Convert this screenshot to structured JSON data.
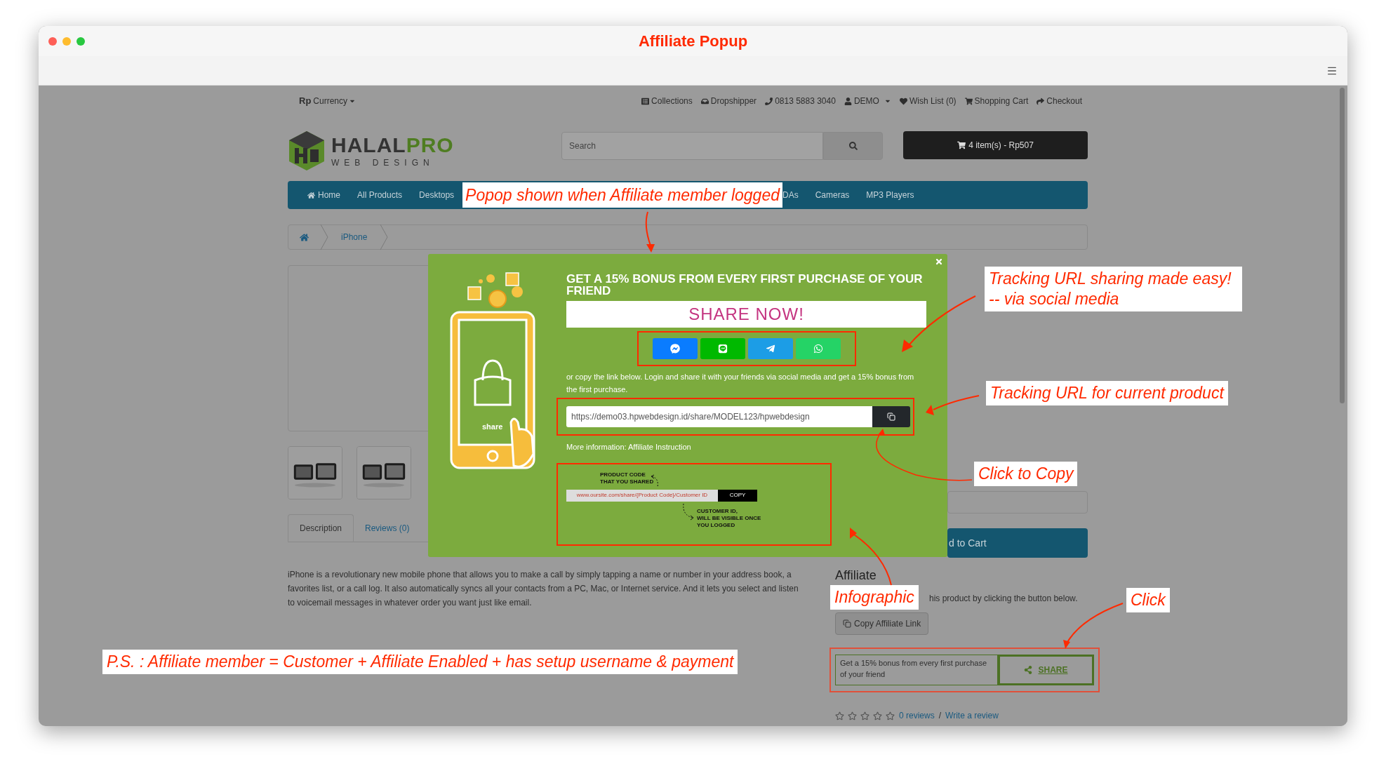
{
  "window": {
    "title": "Affiliate Popup"
  },
  "top_bar": {
    "currency_symbol": "Rp",
    "currency_label": "Currency",
    "links": [
      {
        "label": "Collections",
        "dropdown": false
      },
      {
        "label": "Dropshipper",
        "dropdown": false
      },
      {
        "label": "0813 5883 3040",
        "dropdown": false
      },
      {
        "label": "DEMO",
        "dropdown": true
      },
      {
        "label": "Wish List (0)",
        "dropdown": false
      },
      {
        "label": "Shopping Cart",
        "dropdown": false
      },
      {
        "label": "Checkout",
        "dropdown": false
      }
    ]
  },
  "header": {
    "logo_dark": "HALAL",
    "logo_green": "PRO",
    "logo_sub": "WEB DESIGN",
    "search": {
      "placeholder": "Search"
    },
    "cart": "4 item(s) - Rp507"
  },
  "nav": {
    "items_before": [
      "Home",
      "All Products",
      "Desktops"
    ],
    "annotation": "Popop shown when Affiliate member logged",
    "items_after": [
      "DAs",
      "Cameras",
      "MP3 Players"
    ]
  },
  "breadcrumb": [
    "iPhone"
  ],
  "thumbnails": [
    {
      "kind": "picture"
    },
    {
      "kind": "picture"
    }
  ],
  "tabs": [
    {
      "label": "Description",
      "selected": true
    },
    {
      "label": "Reviews (0)",
      "selected": false
    }
  ],
  "description": "iPhone is a revolutionary new mobile phone that allows you to make a call by simply tapping a name or number in your address book, a favorites list, or a call log. It also automatically syncs all your contacts from a PC, Mac, or Internet service. And it lets you select and listen to voicemail messages in whatever order you want just like email.",
  "right": {
    "cart_button": "d to Cart",
    "affiliate_heading": "Affiliate",
    "affiliate_text": "his product by clicking the button below.",
    "copy_button": "Copy Affiliate Link",
    "share_box": {
      "text": "Get a 15% bonus from every first purchase of your friend",
      "button": "SHARE"
    },
    "stars": 0,
    "reviews_link": "0 reviews",
    "separator": "/",
    "write_link": "Write a review"
  },
  "popup": {
    "illustration_label": "share",
    "heading": "GET A 15% BONUS FROM EVERY FIRST PURCHASE OF YOUR FRIEND",
    "banner": "SHARE NOW!",
    "social": [
      {
        "kind": "messenger",
        "color": "#0a7cff"
      },
      {
        "kind": "line",
        "color": "#00b900"
      },
      {
        "kind": "telegram",
        "color": "#1c9de6"
      },
      {
        "kind": "whatsapp",
        "color": "#25d366"
      }
    ],
    "note": "or copy the link below. Login and share it with your friends via social media and get a 15% bonus from the first purchase.",
    "url": "https://demo03.hpwebdesign.id/share/MODEL123/hpwebdesign",
    "more_info": "More information: Affiliate Instruction",
    "infographic": {
      "top_label": "PRODUCT CODE\nTHAT YOU SHARED",
      "url": "www.oursite.com/share/{Product Code}/Customer ID",
      "button": "COPY",
      "bottom_label": "CUSTOMER ID,\nWILL BE VISIBLE ONCE\nYOU LOGGED"
    }
  },
  "annotations": [
    {
      "text": "Tracking URL sharing made easy!\n-- via social media"
    },
    {
      "text": "Tracking URL for current product"
    },
    {
      "text": "Click to Copy"
    },
    {
      "text": "Infographic"
    },
    {
      "text": "Click"
    },
    {
      "text": "P.S. : Affiliate member = Customer + Affiliate Enabled + has setup username & payment"
    }
  ]
}
